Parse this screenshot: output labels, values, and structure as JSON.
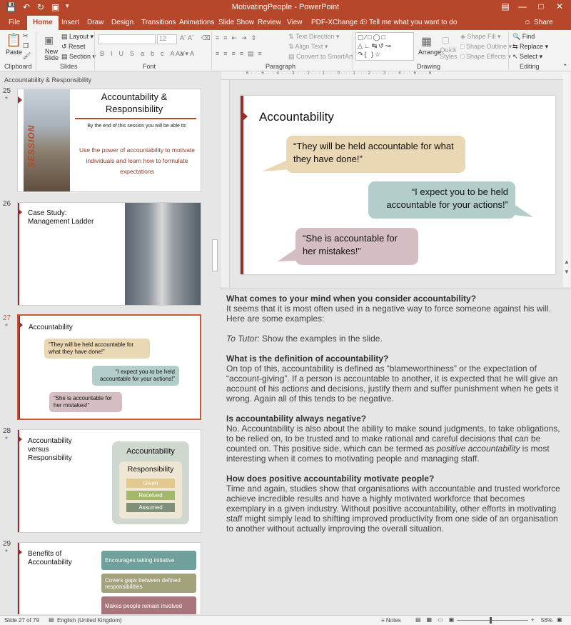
{
  "window": {
    "title": "MotivatingPeople  -  PowerPoint"
  },
  "tabs": [
    {
      "label": "File"
    },
    {
      "label": "Home"
    },
    {
      "label": "Insert"
    },
    {
      "label": "Draw"
    },
    {
      "label": "Design"
    },
    {
      "label": "Transitions"
    },
    {
      "label": "Animations"
    },
    {
      "label": "Slide Show"
    },
    {
      "label": "Review"
    },
    {
      "label": "View"
    },
    {
      "label": "PDF-XChange 4"
    }
  ],
  "tell_me": "Tell me what you want to do",
  "share": "Share",
  "ribbon": {
    "paste": "Paste",
    "new_slide": "New Slide",
    "layout": "Layout",
    "reset": "Reset",
    "section": "Section",
    "font_size": "12",
    "text_direction": "Text Direction",
    "align_text": "Align Text",
    "convert_smartart": "Convert to SmartArt",
    "arrange": "Arrange",
    "quick_styles": "Quick Styles",
    "shape_fill": "Shape Fill",
    "shape_outline": "Shape Outline",
    "shape_effects": "Shape Effects",
    "find": "Find",
    "replace": "Replace",
    "select": "Select",
    "groups": {
      "clipboard": "Clipboard",
      "slides": "Slides",
      "font": "Font",
      "paragraph": "Paragraph",
      "drawing": "Drawing",
      "editing": "Editing"
    }
  },
  "breadcrumb": "Accountability & Responsibility",
  "slides": {
    "s25": {
      "num": "25",
      "title": "Accountability & Responsibility",
      "side": "SESSION",
      "intro": "By the end of this session you will be able to:",
      "goal": "Use the power of accountability to motivate individuals and learn how to formulate expectations"
    },
    "s26": {
      "num": "26",
      "title": "Case Study: Management Ladder"
    },
    "s27": {
      "num": "27",
      "title": "Accountability",
      "b1": "“They will be held accountable for what they have done!”",
      "b2": "“I expect you to be held accountable for your actions!”",
      "b3": "“She is accountable for her mistakes!”"
    },
    "s28": {
      "num": "28",
      "title": "Accountability versus Responsibility",
      "outer": "Accountability",
      "inner": "Responsibility",
      "items": [
        "Given",
        "Received",
        "Assumed"
      ]
    },
    "s29": {
      "num": "29",
      "title": "Benefits of Accountability",
      "items": [
        "Encourages taking initiative",
        "Covers gaps between defined responsibilities",
        "Makes people remain involved"
      ]
    }
  },
  "main_slide": {
    "title": "Accountability",
    "b1": "“They will be held accountable for what they have done!”",
    "b2": "“I expect you to be held accountable for your actions!”",
    "b3": "“She is accountable for her mistakes!”"
  },
  "notes": {
    "h1": "What comes to your mind when you consider accountability?",
    "p1": "It seems that it is most often used in a negative way to force someone against his will. Here are some examples:",
    "tutor_label": "To Tutor:",
    "tutor_text": " Show the examples in the slide.",
    "h2": "What is the definition of accountability?",
    "p2": "On top of this, accountability is defined as “blameworthiness” or the expectation of “account-giving”. If a person is accountable to another, it is expected that he will give an account of his actions and decisions, justify them and suffer punishment when he gets it wrong. Again all of this tends to be negative.",
    "h3": "Is accountability always negative?",
    "p3a": "No. Accountability is also about the ability to make sound judgments, to take obligations, to be relied on, to be trusted and to make rational and careful decisions that can be counted on. This positive side, which can be termed as ",
    "p3em": "positive accountability",
    "p3b": " is most interesting when it comes to motivating people and managing staff.",
    "h4": "How does positive accountability motivate people?",
    "p4": "Time and again, studies show that organisations with accountable and trusted workforce achieve incredible results and have a highly motivated workforce that becomes exemplary in a given industry. Without positive accountability, other efforts in motivating staff might simply lead to shifting improved productivity from one side of an organisation to another without actually improving the overall situation."
  },
  "status": {
    "slide": "Slide 27 of 79",
    "language": "English (United Kingdom)",
    "notes": "Notes",
    "zoom": "56%"
  },
  "colors": {
    "accent": "#b7472a",
    "tan": "#ead7b4",
    "teal": "#b3cdcb",
    "mauve": "#d5bec2"
  }
}
